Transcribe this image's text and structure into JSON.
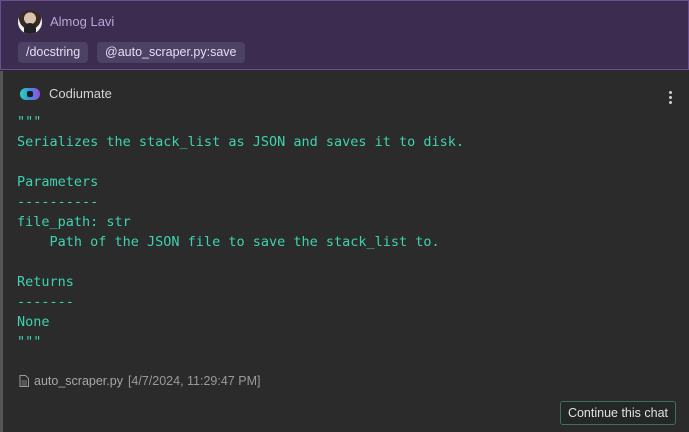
{
  "user_message": {
    "author": "Almog Lavi",
    "chips": [
      "/docstring",
      "@auto_scraper.py:save"
    ]
  },
  "bot_message": {
    "author": "Codiumate",
    "menu_icon": "kebab-menu-icon",
    "code_lines": [
      "\"\"\"",
      "Serializes the stack_list as JSON and saves it to disk.",
      "",
      "Parameters",
      "----------",
      "file_path: str",
      "    Path of the JSON file to save the stack_list to.",
      "",
      "Returns",
      "-------",
      "None",
      "\"\"\""
    ],
    "file_reference": {
      "file_name": "auto_scraper.py",
      "timestamp": "[4/7/2024, 11:29:47 PM]"
    },
    "continue_label": "Continue this chat"
  },
  "colors": {
    "user_bg": "#3b2c50",
    "code_text": "#3ed3b0",
    "button_border": "#3e6f63"
  }
}
